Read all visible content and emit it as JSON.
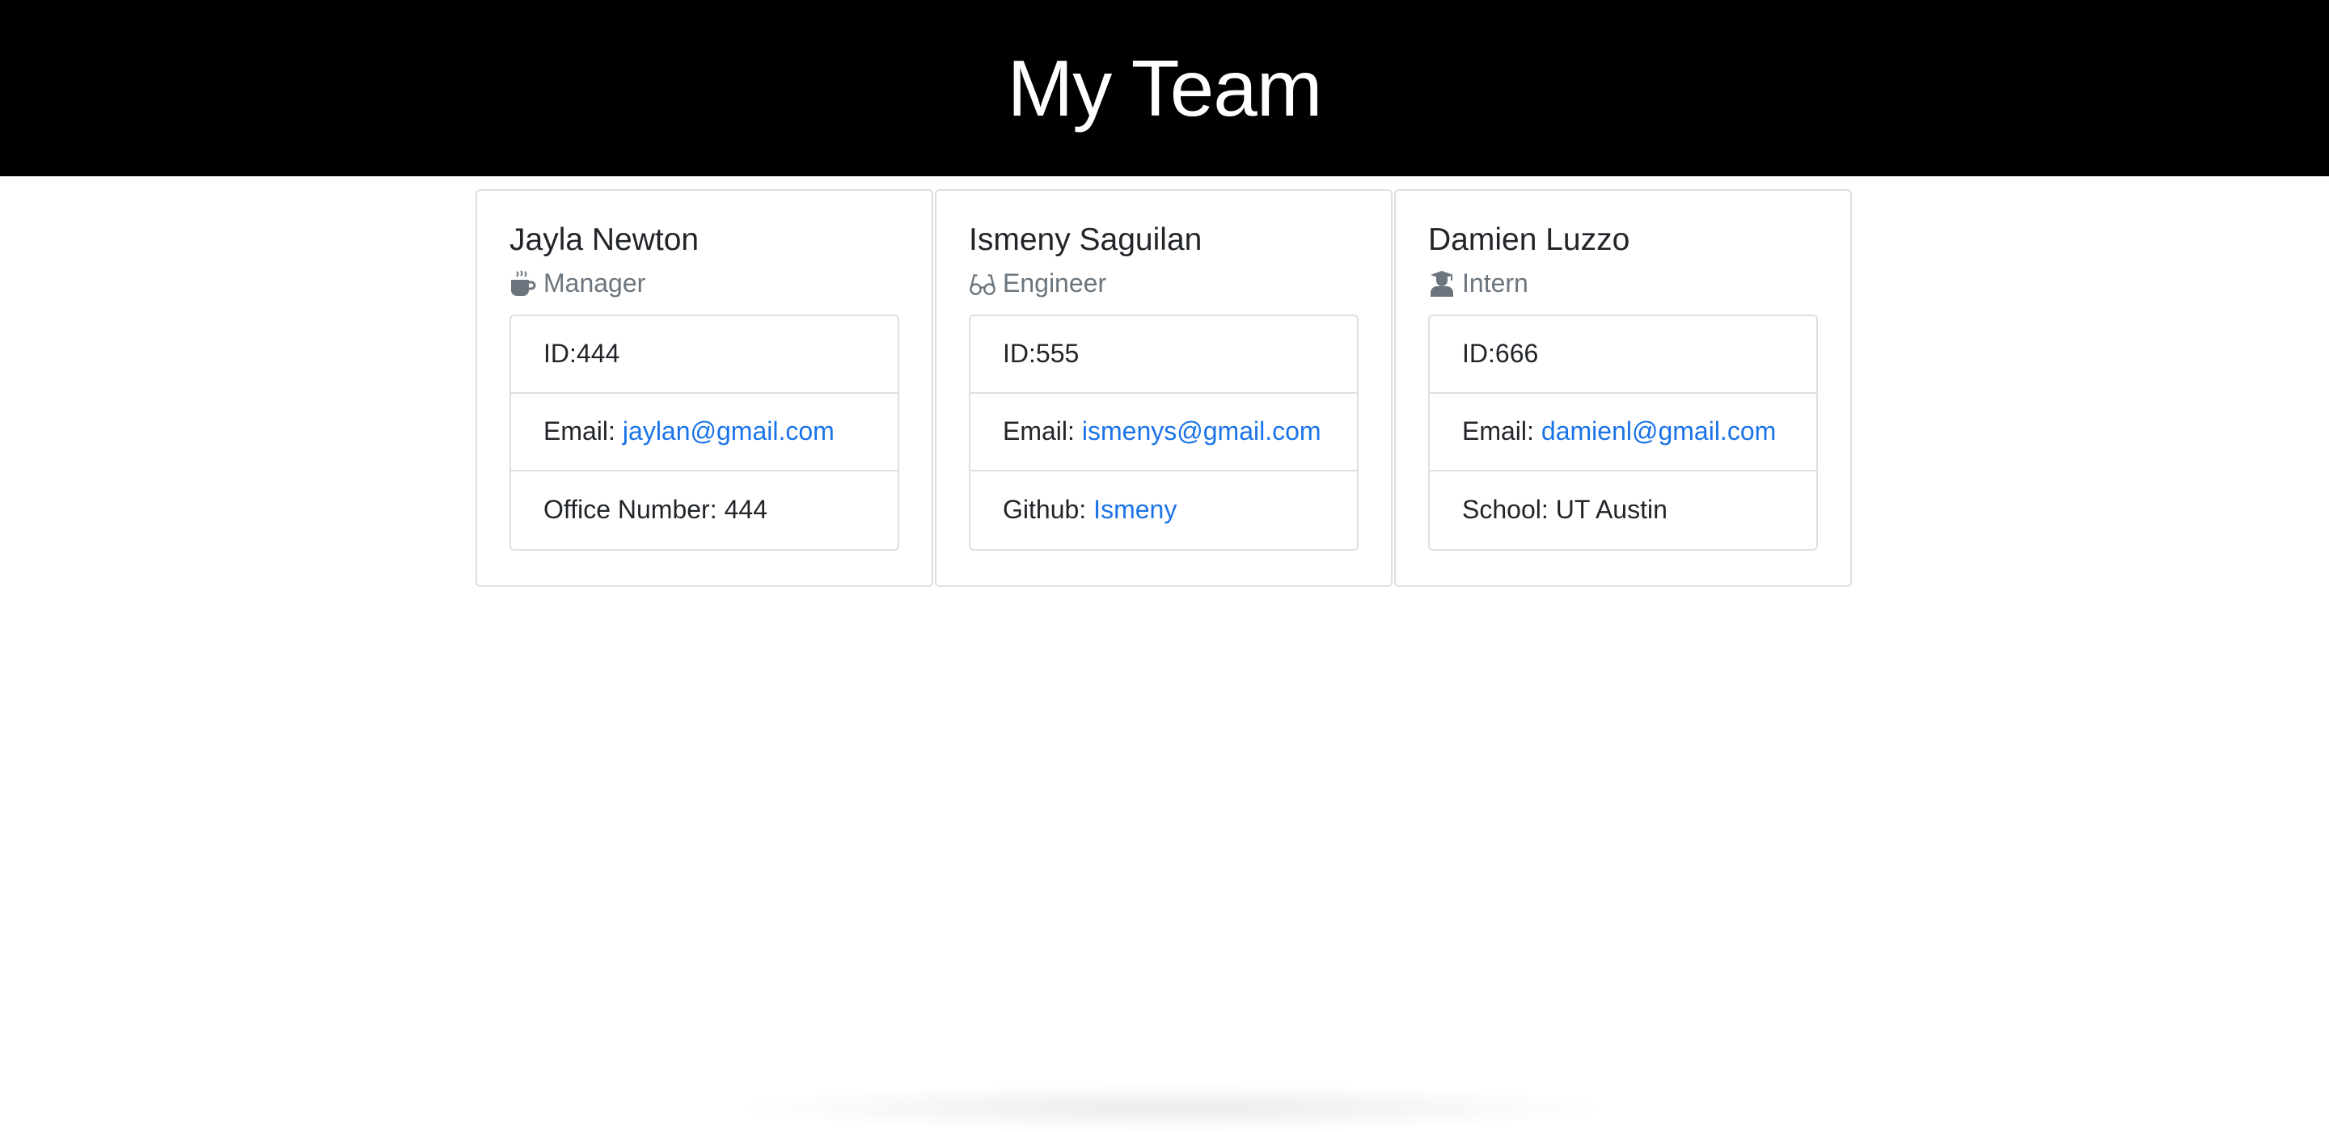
{
  "header": {
    "title": "My Team"
  },
  "employees": [
    {
      "name": "Jayla Newton",
      "role": "Manager",
      "role_icon": "coffee-icon",
      "id_label": "ID:",
      "id": "444",
      "email_label": "Email:",
      "email": "jaylan@gmail.com",
      "extra_label": "Office Number:",
      "extra_value": "444"
    },
    {
      "name": "Ismeny Saguilan",
      "role": "Engineer",
      "role_icon": "glasses-icon",
      "id_label": "ID:",
      "id": "555",
      "email_label": "Email:",
      "email": "ismenys@gmail.com",
      "extra_label": "Github:",
      "extra_value": "Ismeny"
    },
    {
      "name": "Damien Luzzo",
      "role": "Intern",
      "role_icon": "graduate-icon",
      "id_label": "ID:",
      "id": "666",
      "email_label": "Email:",
      "email": "damienl@gmail.com",
      "extra_label": "School:",
      "extra_value": "UT Austin"
    }
  ],
  "colors": {
    "header_bg": "#000000",
    "header_text": "#ffffff",
    "link": "#1a73e8",
    "subtitle": "#6c757d",
    "border": "#dfdfdf"
  }
}
